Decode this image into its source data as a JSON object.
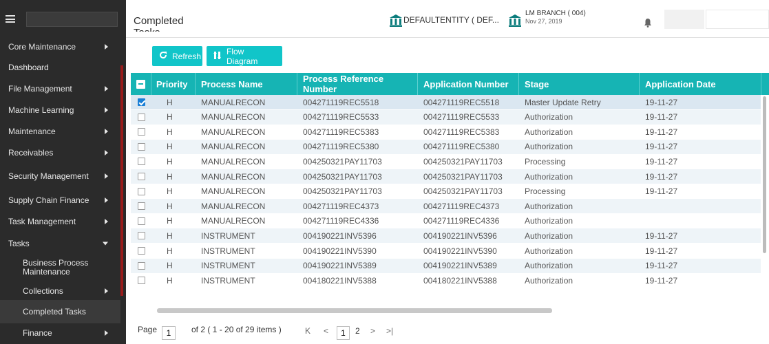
{
  "sidebar": {
    "items": [
      {
        "label": "Core Maintenance",
        "arrow": "right"
      },
      {
        "label": "Dashboard",
        "arrow": ""
      },
      {
        "label": "File Management",
        "arrow": "right"
      },
      {
        "label": "Machine Learning",
        "arrow": "right"
      },
      {
        "label": "Maintenance",
        "arrow": "right"
      },
      {
        "label": "Receivables",
        "arrow": "right"
      },
      {
        "label": "Security Management",
        "arrow": "right"
      },
      {
        "label": "Supply Chain Finance",
        "arrow": "right"
      },
      {
        "label": "Task Management",
        "arrow": "right"
      },
      {
        "label": "Tasks",
        "arrow": "down"
      }
    ],
    "sub_items": [
      {
        "label": "Business Process Maintenance",
        "arrow": ""
      },
      {
        "label": "Collections",
        "arrow": "right"
      },
      {
        "label": "Completed Tasks",
        "arrow": ""
      },
      {
        "label": "Finance",
        "arrow": "right"
      }
    ]
  },
  "header": {
    "title": "Completed Tasks",
    "entity": "DEFAULTENTITY ( DEF...",
    "branch_name": "LM BRANCH  ( 004)",
    "branch_date": "Nov 27, 2019",
    "icons": [
      "bank-icon",
      "bell-icon"
    ]
  },
  "toolbar": {
    "refresh_label": "Refresh",
    "flow_label": "Flow Diagram",
    "accent_color": "#11c5c9"
  },
  "table": {
    "columns": [
      "Priority",
      "Process Name",
      "Process Reference Number",
      "Application Number",
      "Stage",
      "Application Date"
    ],
    "rows": [
      {
        "checked": true,
        "priority": "H",
        "process_name": "MANUALRECON",
        "process_ref": "004271119REC5518",
        "app_number": "004271119REC5518",
        "stage": "Master Update Retry",
        "app_date": "19-11-27"
      },
      {
        "checked": false,
        "priority": "H",
        "process_name": "MANUALRECON",
        "process_ref": "004271119REC5533",
        "app_number": "004271119REC5533",
        "stage": "Authorization",
        "app_date": "19-11-27"
      },
      {
        "checked": false,
        "priority": "H",
        "process_name": "MANUALRECON",
        "process_ref": "004271119REC5383",
        "app_number": "004271119REC5383",
        "stage": "Authorization",
        "app_date": "19-11-27"
      },
      {
        "checked": false,
        "priority": "H",
        "process_name": "MANUALRECON",
        "process_ref": "004271119REC5380",
        "app_number": "004271119REC5380",
        "stage": "Authorization",
        "app_date": "19-11-27"
      },
      {
        "checked": false,
        "priority": "H",
        "process_name": "MANUALRECON",
        "process_ref": "004250321PAY11703",
        "app_number": "004250321PAY11703",
        "stage": "Processing",
        "app_date": "19-11-27"
      },
      {
        "checked": false,
        "priority": "H",
        "process_name": "MANUALRECON",
        "process_ref": "004250321PAY11703",
        "app_number": "004250321PAY11703",
        "stage": "Authorization",
        "app_date": "19-11-27"
      },
      {
        "checked": false,
        "priority": "H",
        "process_name": "MANUALRECON",
        "process_ref": "004250321PAY11703",
        "app_number": "004250321PAY11703",
        "stage": "Processing",
        "app_date": "19-11-27"
      },
      {
        "checked": false,
        "priority": "H",
        "process_name": "MANUALRECON",
        "process_ref": "004271119REC4373",
        "app_number": "004271119REC4373",
        "stage": "Authorization",
        "app_date": ""
      },
      {
        "checked": false,
        "priority": "H",
        "process_name": "MANUALRECON",
        "process_ref": "004271119REC4336",
        "app_number": "004271119REC4336",
        "stage": "Authorization",
        "app_date": ""
      },
      {
        "checked": false,
        "priority": "H",
        "process_name": "INSTRUMENT",
        "process_ref": "004190221INV5396",
        "app_number": "004190221INV5396",
        "stage": "Authorization",
        "app_date": "19-11-27"
      },
      {
        "checked": false,
        "priority": "H",
        "process_name": "INSTRUMENT",
        "process_ref": "004190221INV5390",
        "app_number": "004190221INV5390",
        "stage": "Authorization",
        "app_date": "19-11-27"
      },
      {
        "checked": false,
        "priority": "H",
        "process_name": "INSTRUMENT",
        "process_ref": "004190221INV5389",
        "app_number": "004190221INV5389",
        "stage": "Authorization",
        "app_date": "19-11-27"
      },
      {
        "checked": false,
        "priority": "H",
        "process_name": "INSTRUMENT",
        "process_ref": "004180221INV5388",
        "app_number": "004180221INV5388",
        "stage": "Authorization",
        "app_date": "19-11-27"
      }
    ]
  },
  "pagination": {
    "page_label": "Page",
    "current_page": "1",
    "of_text": "of 2  ( 1 - 20 of 29 items )",
    "first_icon": "K",
    "prev_icon": "<",
    "page_1": "1",
    "page_2": "2",
    "next_icon": ">",
    "last_icon": ">|"
  }
}
